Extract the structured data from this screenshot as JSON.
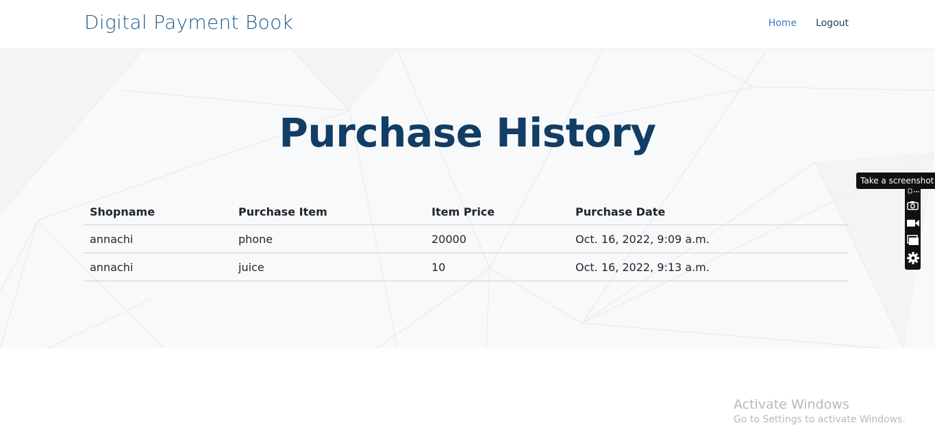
{
  "header": {
    "brand": "Digital Payment Book",
    "nav": [
      {
        "label": "Home"
      },
      {
        "label": "Logout"
      }
    ]
  },
  "main": {
    "title": "Purchase History",
    "table": {
      "columns": [
        "Shopname",
        "Purchase Item",
        "Item Price",
        "Purchase Date"
      ],
      "rows": [
        [
          "annachi",
          "phone",
          "20000",
          "Oct. 16, 2022, 9:09 a.m."
        ],
        [
          "annachi",
          "juice",
          "10",
          "Oct. 16, 2022, 9:13 a.m."
        ]
      ]
    }
  },
  "overlay": {
    "tooltip": "Take a screenshot",
    "tools": [
      "screenshot-icon",
      "video-camera-icon",
      "window-icon",
      "gear-icon"
    ]
  },
  "windows_notice": {
    "title": "Activate Windows",
    "subtitle": "Go to Settings to activate Windows."
  },
  "colors": {
    "brand": "#1f5a8c",
    "title": "#123d64",
    "nav_active": "#3a7bbf"
  }
}
